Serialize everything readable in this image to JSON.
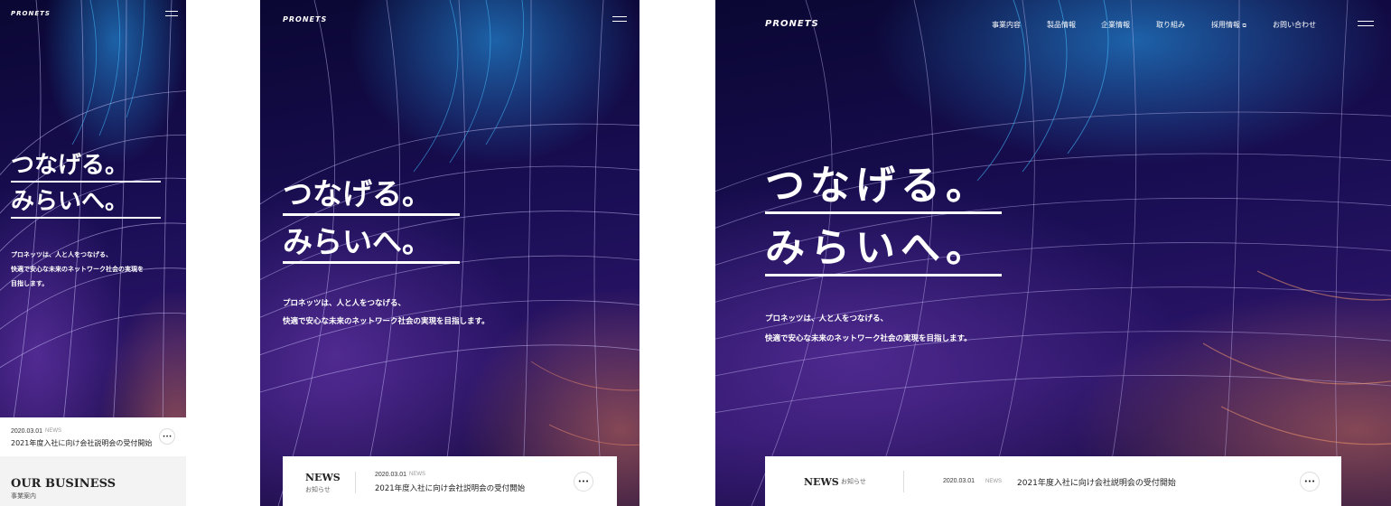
{
  "brand": {
    "logo": "PRONETS"
  },
  "hero": {
    "line1": "つなげる。",
    "line2": "みらいへ。",
    "lead1": "プロネッツは、人と人をつなげる、",
    "lead2": "快適で安心な未来のネットワーク社会の実現を目指します。",
    "lead_mobile1": "プロネッツは、人と人をつなげる、",
    "lead_mobile2": "快適で安心な未来のネットワーク社会の実現を",
    "lead_mobile3": "目指します。"
  },
  "news": {
    "title": "NEWS",
    "subtitle": "お知らせ",
    "date": "2020.03.01",
    "tag": "NEWS",
    "headline": "2021年度入社に向け会社説明会の受付開始",
    "more": "•••"
  },
  "business": {
    "title": "OUR BUSINESS",
    "subtitle": "事業案内"
  },
  "nav": {
    "items": [
      "事業内容",
      "製品情報",
      "企業情報",
      "取り組み",
      "採用情報",
      "お問い合わせ"
    ],
    "recruit_icon": "external-link-icon"
  }
}
